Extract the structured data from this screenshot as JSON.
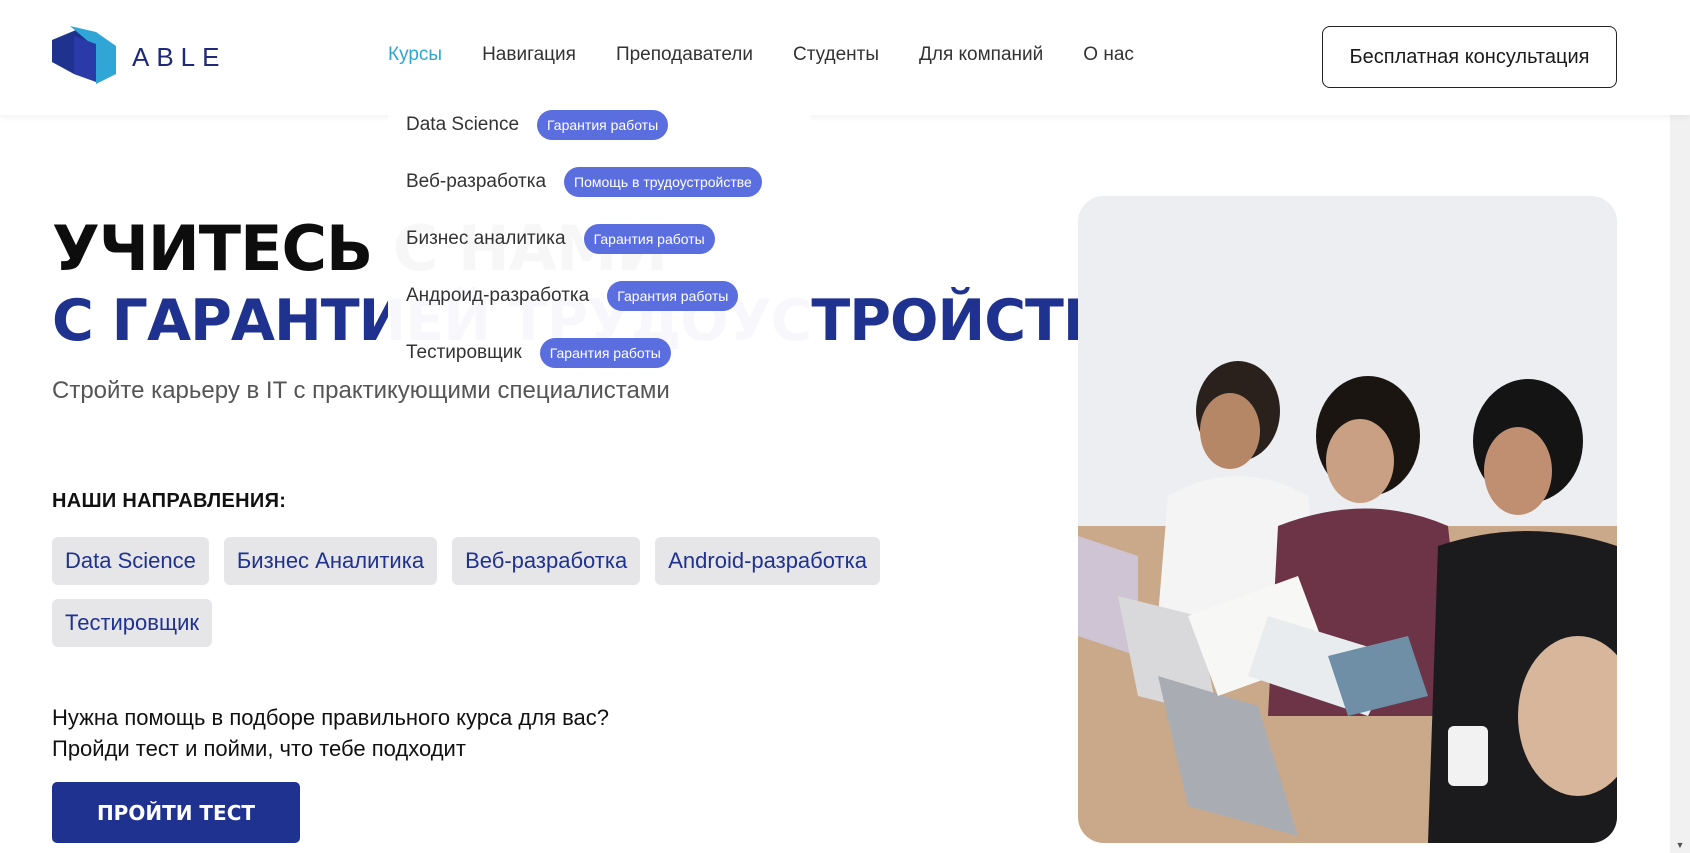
{
  "header": {
    "logo_text": "ABLE",
    "nav": [
      "Курсы",
      "Навигация",
      "Преподаватели",
      "Студенты",
      "Для компаний",
      "О нас"
    ],
    "active_nav": "Курсы",
    "consult_button": "Бесплатная консультация"
  },
  "dropdown": {
    "items": [
      {
        "label": "Data Science",
        "badge": "Гарантия работы"
      },
      {
        "label": "Веб-разработка",
        "badge": "Помощь в трудоустройстве"
      },
      {
        "label": "Бизнес аналитика",
        "badge": "Гарантия работы"
      },
      {
        "label": "Андроид-разработка",
        "badge": "Гарантия работы"
      },
      {
        "label": "Тестировщик",
        "badge": "Гарантия работы"
      }
    ]
  },
  "hero": {
    "title_line1": "УЧИТЕСЬ С НАМИ",
    "title_line2": "С ГАРАНТИЕЙ ТРУДОУСТРОЙСТВА",
    "subtitle": "Стройте карьеру в IT с практикующими специалистами"
  },
  "directions": {
    "heading": "НАШИ НАПРАВЛЕНИЯ:",
    "chips": [
      "Data Science",
      "Бизнес Аналитика",
      "Веб-разработка",
      "Android-разработка",
      "Тестировщик"
    ]
  },
  "help": {
    "line1": "Нужна помощь в подборе правильного курса для вас?",
    "line2": "Пройди тест и пойми, что тебе подходит",
    "button": "ПРОЙТИ ТЕСТ"
  },
  "colors": {
    "brand_blue": "#1f3290",
    "active_nav": "#2fa6d6",
    "badge": "#5b6ee0",
    "chip_bg": "#e6e6e8"
  }
}
